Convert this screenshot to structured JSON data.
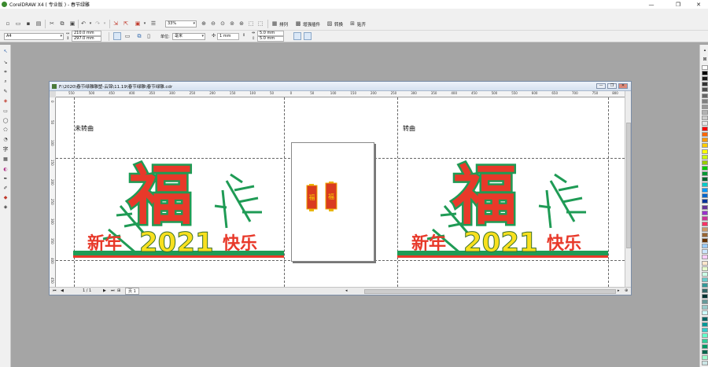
{
  "window": {
    "title": "CorelDRAW X4 ( 专业版 ) - 春节绿雕",
    "min": "—",
    "restore": "❐",
    "close": "✕"
  },
  "toolbar1": {
    "zoom_value": "33%",
    "import_label": "排列",
    "adjust_label": "增强插件",
    "convert_label": "转换",
    "paste_label": "贴齐"
  },
  "toolbar2": {
    "paper_size": "A4",
    "width": "210.0 mm",
    "height": "297.0 mm",
    "units_label": "单位:",
    "units_value": "毫米",
    "nudge": "1 mm",
    "dup_x": "5.0 mm",
    "dup_y": "5.0 mm"
  },
  "document": {
    "title": "F:\\2020\\春节绿雕雕塑-云锦\\11.19\\春节绿雕\\春节绿雕.cdr",
    "min": "—",
    "restore": "❐",
    "close": "✕",
    "ruler_top_labels": [
      "550",
      "500",
      "450",
      "400",
      "350",
      "300",
      "250",
      "200",
      "150",
      "100",
      "50",
      "0",
      "50",
      "100",
      "150",
      "200",
      "250",
      "300",
      "350",
      "400",
      "450",
      "500",
      "550",
      "600",
      "650",
      "700",
      "750",
      "800"
    ],
    "ruler_left_labels": [
      "0",
      "50",
      "100",
      "150",
      "200",
      "250",
      "300",
      "350",
      "400",
      "450"
    ],
    "left_panel_label": "未转曲",
    "right_panel_label": "转曲",
    "banner_text": "新年",
    "year": "2021",
    "happy": "快乐",
    "fu": "福",
    "lantern_char": "福"
  },
  "statusbar": {
    "page_counter": "1 / 1",
    "page_tab": "页 1"
  },
  "palette_colors": [
    "#ffffff",
    "#000000",
    "#1a1a1a",
    "#333333",
    "#4d4d4d",
    "#666666",
    "#808080",
    "#999999",
    "#b3b3b3",
    "#cccccc",
    "#e6e6e6",
    "#ff0000",
    "#ff6600",
    "#ff9900",
    "#ffcc00",
    "#ffff00",
    "#ccff00",
    "#99cc00",
    "#00cc00",
    "#009933",
    "#006633",
    "#00cccc",
    "#0099ff",
    "#0066cc",
    "#003399",
    "#663399",
    "#9933cc",
    "#cc3399",
    "#ff3366",
    "#cc9966",
    "#996633",
    "#663300",
    "#99ccff",
    "#cce6ff",
    "#ffccff",
    "#ffe6cc",
    "#e6ffcc",
    "#ccffe6",
    "#66cccc",
    "#339999",
    "#336666",
    "#003333",
    "#669999",
    "#99cccc",
    "#ccffff",
    "#006666",
    "#009999",
    "#33cccc",
    "#66ffcc",
    "#33cc99",
    "#009966",
    "#00664d",
    "#99ffcc",
    "#cce6e6"
  ]
}
